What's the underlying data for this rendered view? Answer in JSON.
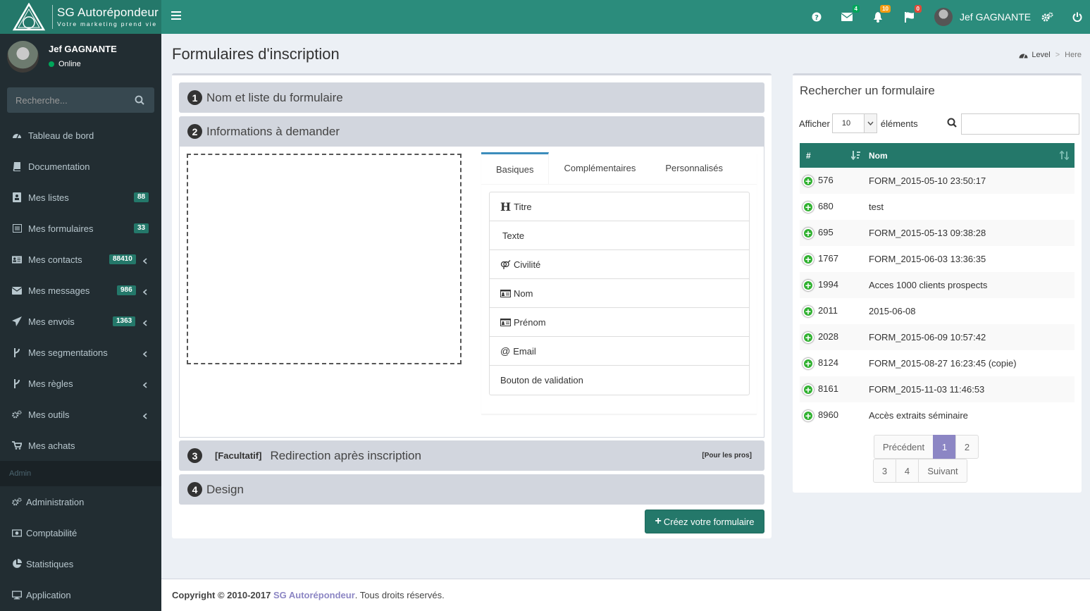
{
  "brand": {
    "name": "SG Autorépondeur",
    "tagline": "Votre marketing prend vie",
    "mark": "SG"
  },
  "colors": {
    "primary": "#24786a",
    "topbar": "#2b8c7c",
    "sidebar": "#222d32",
    "accent": "#8c86c4"
  },
  "header": {
    "user_name": "Jef GAGNANTE",
    "icons": [
      {
        "name": "help-icon",
        "badge": ""
      },
      {
        "name": "envelope-icon",
        "badge": "4"
      },
      {
        "name": "bell-icon",
        "badge": "10"
      },
      {
        "name": "flag-icon",
        "badge": "0"
      }
    ]
  },
  "sidebar": {
    "user_name": "Jef GAGNANTE",
    "status": "Online",
    "search_placeholder": "Recherche...",
    "items": [
      {
        "label": "Tableau de bord",
        "icon": "dashboard-icon",
        "count": "",
        "chevron": false
      },
      {
        "label": "Documentation",
        "icon": "book-icon",
        "count": "",
        "chevron": false
      },
      {
        "label": "Mes listes",
        "icon": "list-icon",
        "count": "88",
        "chevron": false
      },
      {
        "label": "Mes formulaires",
        "icon": "form-icon",
        "count": "33",
        "chevron": false
      },
      {
        "label": "Mes contacts",
        "icon": "contact-card-icon",
        "count": "88410",
        "chevron": true
      },
      {
        "label": "Mes messages",
        "icon": "envelope-icon",
        "count": "986",
        "chevron": true
      },
      {
        "label": "Mes envois",
        "icon": "paper-plane-icon",
        "count": "1363",
        "chevron": true
      },
      {
        "label": "Mes segmentations",
        "icon": "branch-icon",
        "count": "",
        "chevron": true
      },
      {
        "label": "Mes règles",
        "icon": "branch-icon",
        "count": "",
        "chevron": true
      },
      {
        "label": "Mes outils",
        "icon": "cogs-icon",
        "count": "",
        "chevron": true
      },
      {
        "label": "Mes achats",
        "icon": "cart-icon",
        "count": "",
        "chevron": false
      }
    ],
    "admin_header": "Admin",
    "admin_items": [
      {
        "label": "Administration",
        "icon": "cogs-icon"
      },
      {
        "label": "Comptabilité",
        "icon": "money-icon"
      },
      {
        "label": "Statistiques",
        "icon": "pie-chart-icon"
      },
      {
        "label": "Application",
        "icon": "desktop-icon"
      }
    ]
  },
  "main": {
    "title": "Formulaires d'inscription",
    "breadcrumb": {
      "level": "Level",
      "here": "Here"
    },
    "sections": [
      {
        "num": "1",
        "label": "Nom et liste du formulaire"
      },
      {
        "num": "2",
        "label": "Informations à demander"
      },
      {
        "num": "3",
        "tag": "[Facultatif]",
        "label": "Redirection après inscription",
        "note": "[Pour les pros]"
      },
      {
        "num": "4",
        "label": "Design"
      }
    ],
    "tabs": [
      "Basiques",
      "Complémentaires",
      "Personnalisés"
    ],
    "fields": [
      {
        "label": "Titre",
        "icon": "heading-icon"
      },
      {
        "label": "Texte",
        "icon": ""
      },
      {
        "label": "Civilité",
        "icon": "gender-icon"
      },
      {
        "label": "Nom",
        "icon": "id-card-icon"
      },
      {
        "label": "Prénom",
        "icon": "id-card-icon"
      },
      {
        "label": "Email",
        "icon": "at-icon"
      },
      {
        "label": "Bouton de validation",
        "icon": ""
      }
    ],
    "create_button": "Créez votre formulaire"
  },
  "search_panel": {
    "title": "Rechercher un formulaire",
    "show_label": "Afficher",
    "page_size": "10",
    "elements_label": "éléments",
    "columns": [
      "#",
      "Nom"
    ],
    "rows": [
      {
        "id": "576",
        "name": "FORM_2015-05-10 23:50:17"
      },
      {
        "id": "680",
        "name": "test"
      },
      {
        "id": "695",
        "name": "FORM_2015-05-13 09:38:28"
      },
      {
        "id": "1767",
        "name": "FORM_2015-06-03 13:36:35"
      },
      {
        "id": "1994",
        "name": "Acces 1000 clients prospects"
      },
      {
        "id": "2011",
        "name": "2015-06-08"
      },
      {
        "id": "2028",
        "name": "FORM_2015-06-09 10:57:42"
      },
      {
        "id": "8124",
        "name": "FORM_2015-08-27 16:23:45 (copie)"
      },
      {
        "id": "8161",
        "name": "FORM_2015-11-03 11:46:53"
      },
      {
        "id": "8960",
        "name": "Accès extraits séminaire"
      }
    ],
    "pagination": {
      "prev": "Précédent",
      "next": "Suivant",
      "pages": [
        "1",
        "2",
        "3",
        "4"
      ],
      "current": "1"
    }
  },
  "footer": {
    "copyright": "Copyright © 2010-2017",
    "brand": "SG Autorépondeur",
    "rights": ". Tous droits réservés."
  }
}
